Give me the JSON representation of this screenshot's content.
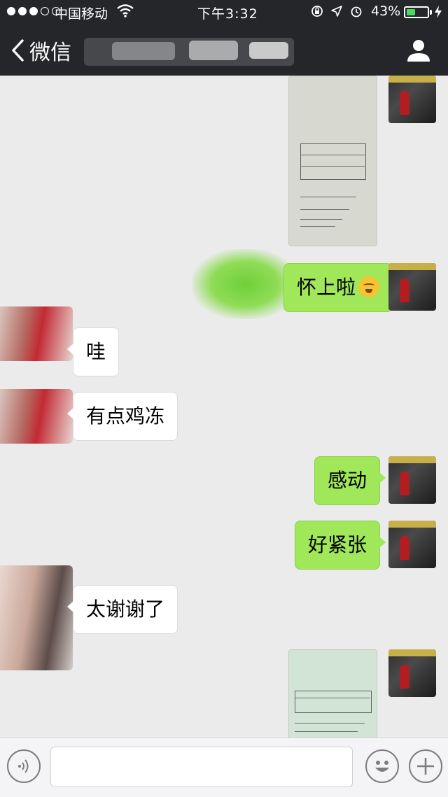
{
  "status_bar": {
    "carrier": "中国移动",
    "time": "下午3:32",
    "battery_percent": "43%",
    "battery_level": 0.43
  },
  "nav": {
    "back_label": "微信"
  },
  "messages": [
    {
      "side": "me",
      "type": "image"
    },
    {
      "side": "me",
      "type": "text",
      "text": "怀上啦",
      "emoji": "blushing-face-icon"
    },
    {
      "side": "them",
      "type": "text",
      "text": "哇"
    },
    {
      "side": "them",
      "type": "text",
      "text": "有点鸡冻"
    },
    {
      "side": "me",
      "type": "text",
      "text": "感动"
    },
    {
      "side": "me",
      "type": "text",
      "text": "好紧张"
    },
    {
      "side": "them",
      "type": "text",
      "text": "太谢谢了"
    },
    {
      "side": "me",
      "type": "image"
    }
  ],
  "input": {
    "value": ""
  },
  "colors": {
    "nav_bg": "#24262a",
    "chat_bg": "#ebebeb",
    "my_bubble": "#a0e75a",
    "their_bubble": "#ffffff",
    "battery": "#4cd964"
  }
}
